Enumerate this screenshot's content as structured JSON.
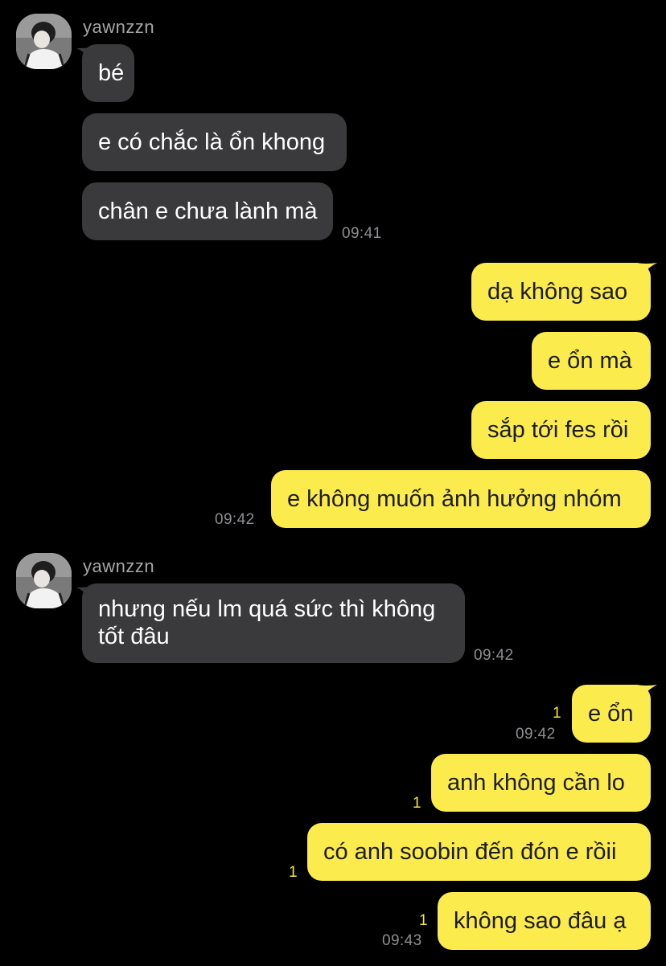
{
  "colors": {
    "background": "#000000",
    "incoming_bubble": "#3a3a3c",
    "outgoing_bubble": "#fbeb4c",
    "timestamp": "#8e8e93",
    "unread_count": "#f7e24a"
  },
  "groups": [
    {
      "sender": "yawnzzn",
      "messages": [
        "bé",
        "e có chắc là ổn khong",
        "chân e chưa lành mà"
      ],
      "time": "09:41"
    },
    {
      "outgoing": true,
      "messages": [
        "dạ không sao",
        "e ổn mà",
        "sắp tới fes rồi",
        "e không muốn ảnh hưởng nhóm"
      ],
      "time": "09:42"
    },
    {
      "sender": "yawnzzn",
      "messages": [
        "nhưng nếu lm quá sức thì không tốt đâu"
      ],
      "time": "09:42"
    },
    {
      "outgoing": true,
      "messages": [
        "e ổn",
        "anh không cần lo",
        "có anh soobin đến đón e rồii",
        "không sao đâu ạ"
      ],
      "unread": [
        "1",
        "1",
        "1",
        "1"
      ],
      "times": [
        "09:42",
        "09:43"
      ]
    }
  ]
}
